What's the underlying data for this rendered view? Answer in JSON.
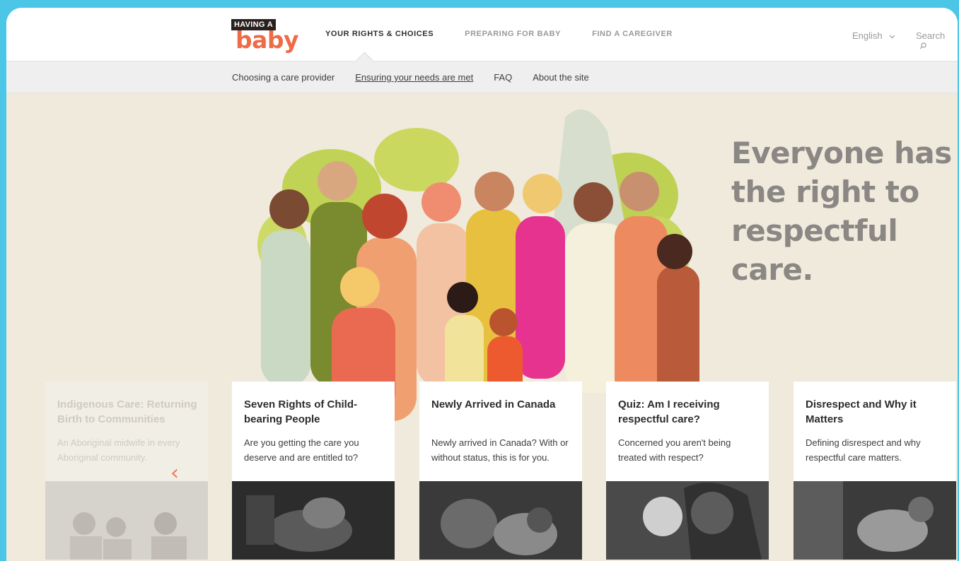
{
  "logo": {
    "line1": "HAVING A",
    "line2": "baby"
  },
  "main_nav": [
    {
      "label": "YOUR RIGHTS & CHOICES",
      "active": true
    },
    {
      "label": "PREPARING FOR BABY",
      "active": false
    },
    {
      "label": "FIND A CAREGIVER",
      "active": false
    }
  ],
  "language": {
    "label": "English",
    "icon": "chevron-down-icon"
  },
  "search": {
    "label": "Search"
  },
  "sub_nav": [
    {
      "label": "Choosing a care provider"
    },
    {
      "label": "Ensuring your needs are met",
      "current": true
    },
    {
      "label": "FAQ"
    },
    {
      "label": "About the site"
    }
  ],
  "hero": {
    "headline": "Everyone has the right to respectful care."
  },
  "cards": [
    {
      "title": "Indigenous Care: Returning Birth to Communities",
      "desc": "An Aboriginal midwife in every Aboriginal community.",
      "faded": true
    },
    {
      "title": "Seven Rights of Child-bearing People",
      "desc": "Are you getting the care you deserve and are entitled to?"
    },
    {
      "title": "Newly Arrived in Canada",
      "desc": "Newly arrived in Canada? With or without status, this is for you."
    },
    {
      "title": "Quiz: Am I receiving respectful care?",
      "desc": "Concerned you aren't being treated with respect?"
    },
    {
      "title": "Disrespect and Why it Matters",
      "desc": "Defining disrespect and why respectful care matters."
    }
  ],
  "colors": {
    "accent": "#ee6b47",
    "frame": "#4cc6e6",
    "hero_bg": "#efeadc"
  }
}
